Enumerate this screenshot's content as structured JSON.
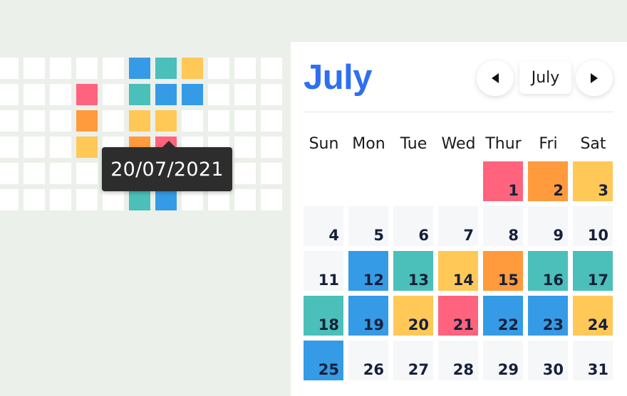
{
  "colors": {
    "blue": "#369be6",
    "teal": "#4bbfb9",
    "yellow": "#ffc857",
    "orange": "#ff9b3d",
    "pink": "#ff637d",
    "empty": "#f6f7f9"
  },
  "tooltip": {
    "text": "20/07/2021"
  },
  "calendar": {
    "title": "July",
    "month_selector": "July",
    "prev_icon": "triangle-left-icon",
    "next_icon": "triangle-right-icon",
    "weekdays": [
      "Sun",
      "Mon",
      "Tue",
      "Wed",
      "Thur",
      "Fri",
      "Sat"
    ],
    "days": [
      {
        "day": "1",
        "color": "pink"
      },
      {
        "day": "2",
        "color": "orange"
      },
      {
        "day": "3",
        "color": "yellow"
      },
      {
        "day": "4",
        "color": "empty"
      },
      {
        "day": "5",
        "color": "empty"
      },
      {
        "day": "6",
        "color": "empty"
      },
      {
        "day": "7",
        "color": "empty"
      },
      {
        "day": "8",
        "color": "empty"
      },
      {
        "day": "9",
        "color": "empty"
      },
      {
        "day": "10",
        "color": "empty"
      },
      {
        "day": "11",
        "color": "empty"
      },
      {
        "day": "12",
        "color": "blue"
      },
      {
        "day": "13",
        "color": "teal"
      },
      {
        "day": "14",
        "color": "yellow"
      },
      {
        "day": "15",
        "color": "orange"
      },
      {
        "day": "16",
        "color": "teal"
      },
      {
        "day": "17",
        "color": "teal"
      },
      {
        "day": "18",
        "color": "teal"
      },
      {
        "day": "19",
        "color": "blue"
      },
      {
        "day": "20",
        "color": "yellow"
      },
      {
        "day": "21",
        "color": "pink"
      },
      {
        "day": "22",
        "color": "blue"
      },
      {
        "day": "23",
        "color": "blue"
      },
      {
        "day": "24",
        "color": "yellow"
      },
      {
        "day": "25",
        "color": "blue"
      },
      {
        "day": "26",
        "color": "empty"
      },
      {
        "day": "27",
        "color": "empty"
      },
      {
        "day": "28",
        "color": "empty"
      },
      {
        "day": "29",
        "color": "empty"
      },
      {
        "day": "30",
        "color": "empty"
      },
      {
        "day": "31",
        "color": "empty"
      }
    ]
  },
  "heatmap": {
    "colored_cells": [
      {
        "row": 0,
        "col": 5,
        "color": "blue"
      },
      {
        "row": 0,
        "col": 6,
        "color": "teal"
      },
      {
        "row": 0,
        "col": 7,
        "color": "yellow"
      },
      {
        "row": 1,
        "col": 3,
        "color": "pink"
      },
      {
        "row": 1,
        "col": 5,
        "color": "teal"
      },
      {
        "row": 1,
        "col": 6,
        "color": "blue"
      },
      {
        "row": 1,
        "col": 7,
        "color": "blue"
      },
      {
        "row": 2,
        "col": 3,
        "color": "orange"
      },
      {
        "row": 2,
        "col": 5,
        "color": "yellow"
      },
      {
        "row": 2,
        "col": 6,
        "color": "yellow"
      },
      {
        "row": 3,
        "col": 3,
        "color": "yellow"
      },
      {
        "row": 3,
        "col": 5,
        "color": "orange"
      },
      {
        "row": 3,
        "col": 6,
        "color": "pink"
      },
      {
        "row": 4,
        "col": 5,
        "color": "teal"
      },
      {
        "row": 4,
        "col": 6,
        "color": "blue"
      },
      {
        "row": 5,
        "col": 5,
        "color": "teal"
      },
      {
        "row": 5,
        "col": 6,
        "color": "blue"
      }
    ]
  }
}
